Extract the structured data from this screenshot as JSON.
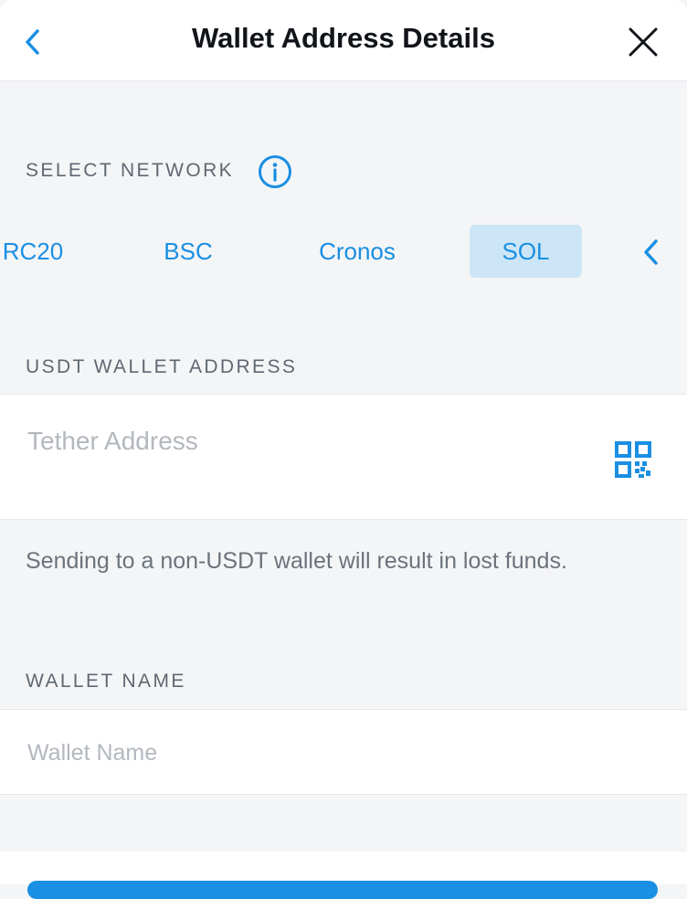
{
  "header": {
    "title": "Wallet Address Details"
  },
  "network": {
    "label": "SELECT NETWORK",
    "tabs": [
      {
        "label": "RC20"
      },
      {
        "label": "BSC"
      },
      {
        "label": "Cronos"
      },
      {
        "label": "SOL",
        "active": true
      }
    ]
  },
  "address": {
    "label": "USDT WALLET ADDRESS",
    "placeholder": "Tether Address",
    "note": "Sending to a non-USDT wallet will result in lost funds."
  },
  "wallet_name": {
    "label": "WALLET NAME",
    "placeholder": "Wallet Name"
  },
  "colors": {
    "accent": "#1a8fe3",
    "active_tab_bg": "#cde6f7",
    "background": "#f4f5f7"
  }
}
